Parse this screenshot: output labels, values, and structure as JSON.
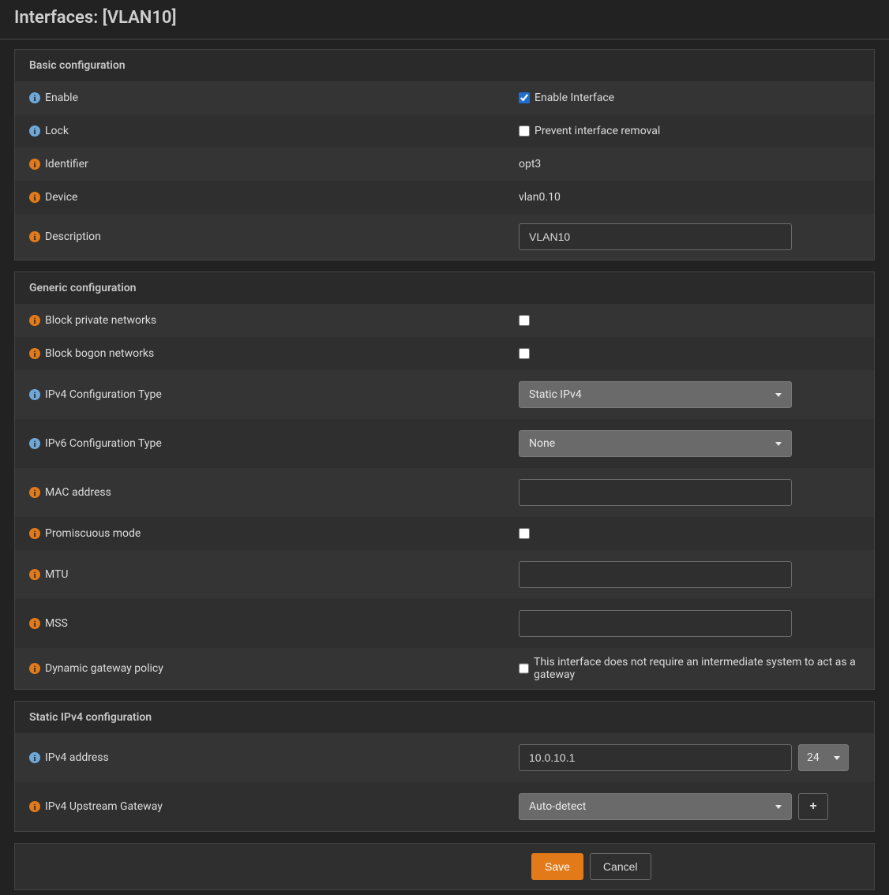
{
  "page_title": "Interfaces: [VLAN10]",
  "sections": {
    "basic": {
      "header": "Basic configuration",
      "enable_label": "Enable",
      "enable_cb_label": "Enable Interface",
      "enable_checked": true,
      "lock_label": "Lock",
      "lock_cb_label": "Prevent interface removal",
      "lock_checked": false,
      "identifier_label": "Identifier",
      "identifier_value": "opt3",
      "device_label": "Device",
      "device_value": "vlan0.10",
      "description_label": "Description",
      "description_value": "VLAN10"
    },
    "generic": {
      "header": "Generic configuration",
      "block_private_label": "Block private networks",
      "block_private_checked": false,
      "block_bogon_label": "Block bogon networks",
      "block_bogon_checked": false,
      "ipv4_cfg_label": "IPv4 Configuration Type",
      "ipv4_cfg_value": "Static IPv4",
      "ipv6_cfg_label": "IPv6 Configuration Type",
      "ipv6_cfg_value": "None",
      "mac_label": "MAC address",
      "mac_value": "",
      "promisc_label": "Promiscuous mode",
      "promisc_checked": false,
      "mtu_label": "MTU",
      "mtu_value": "",
      "mss_label": "MSS",
      "mss_value": "",
      "dyn_gw_label": "Dynamic gateway policy",
      "dyn_gw_cb_label": "This interface does not require an intermediate system to act as a gateway",
      "dyn_gw_checked": false
    },
    "static_ipv4": {
      "header": "Static IPv4 configuration",
      "addr_label": "IPv4 address",
      "addr_value": "10.0.10.1",
      "cidr_value": "24",
      "gw_label": "IPv4 Upstream Gateway",
      "gw_value": "Auto-detect"
    }
  },
  "buttons": {
    "save": "Save",
    "cancel": "Cancel"
  }
}
